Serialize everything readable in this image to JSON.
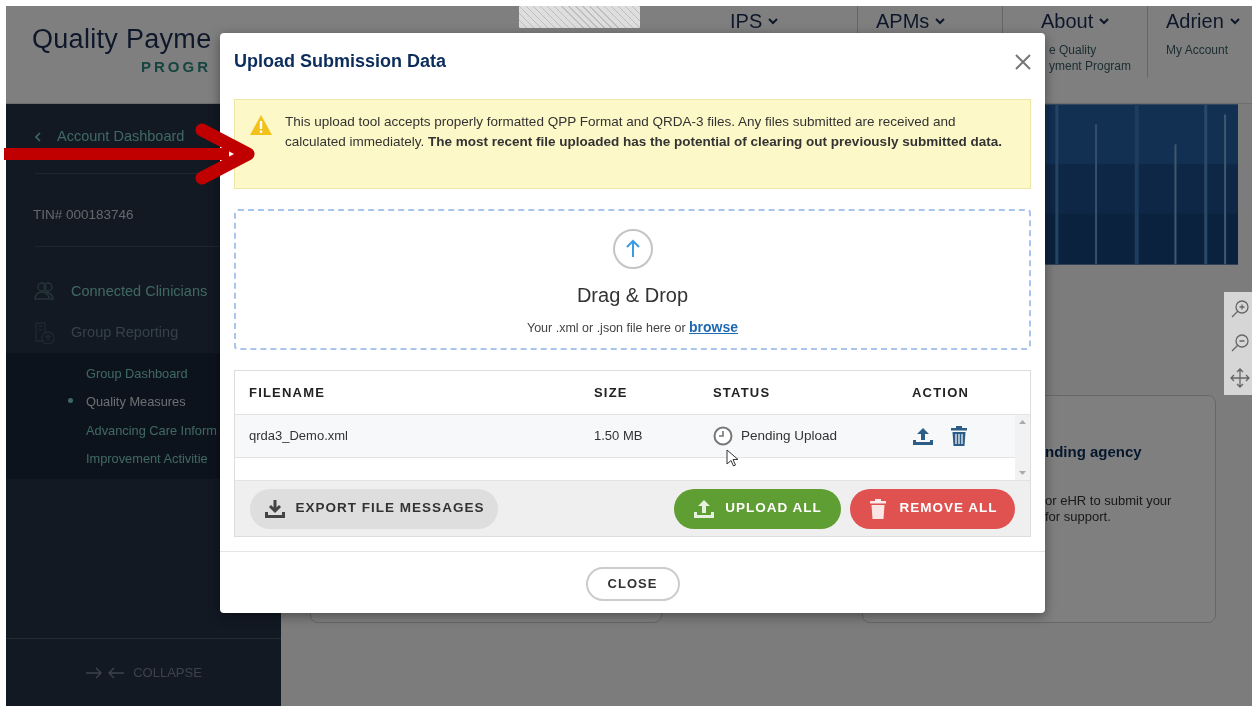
{
  "header": {
    "logo": {
      "line1": "Quality Payme",
      "line2": "PROGR"
    },
    "nav": [
      {
        "label": "IPS"
      },
      {
        "label": "APMs"
      },
      {
        "label": "About",
        "sub": [
          "e Quality",
          "yment Program"
        ]
      },
      {
        "label": "Adrien",
        "sub": [
          "My Account"
        ]
      }
    ]
  },
  "sidebar": {
    "back_link": "Account Dashboard",
    "tin": "TIN# 000183746",
    "items": [
      {
        "label": "Connected Clinicians",
        "kind": "clinicians"
      },
      {
        "label": "Group Reporting",
        "kind": "reporting",
        "children": [
          {
            "label": "Group Dashboard",
            "selected": false
          },
          {
            "label": "Quality Measures",
            "selected": true
          },
          {
            "label": "Advancing Care Inform",
            "selected": false
          },
          {
            "label": "Improvement Activitie",
            "selected": false
          }
        ]
      }
    ],
    "collapse": "COLLAPSE"
  },
  "background_card": {
    "title": "nding agency",
    "lines": [
      "or eHR to submit your",
      "for support."
    ]
  },
  "modal": {
    "title": "Upload Submission Data",
    "alert": "This upload tool accepts properly formatted QPP Format and QRDA-3 files. Any files submitted are received and calculated immediately. **The most recent file uploaded has the potential of clearing out previously submitted data.**",
    "dropzone": {
      "title": "Drag & Drop",
      "hint": "Your .xml or .json file here or",
      "link": "browse"
    },
    "table": {
      "columns": [
        "FILENAME",
        "SIZE",
        "STATUS",
        "ACTION"
      ],
      "rows": [
        {
          "filename": "qrda3_Demo.xml",
          "size": "1.50 MB",
          "status": "Pending Upload"
        }
      ]
    },
    "buttons": [
      {
        "label": "EXPORT FILE MESSAGES",
        "kind": "export"
      },
      {
        "label": "UPLOAD ALL",
        "kind": "upload"
      },
      {
        "label": "REMOVE ALL",
        "kind": "remove"
      }
    ],
    "close": "CLOSE"
  }
}
